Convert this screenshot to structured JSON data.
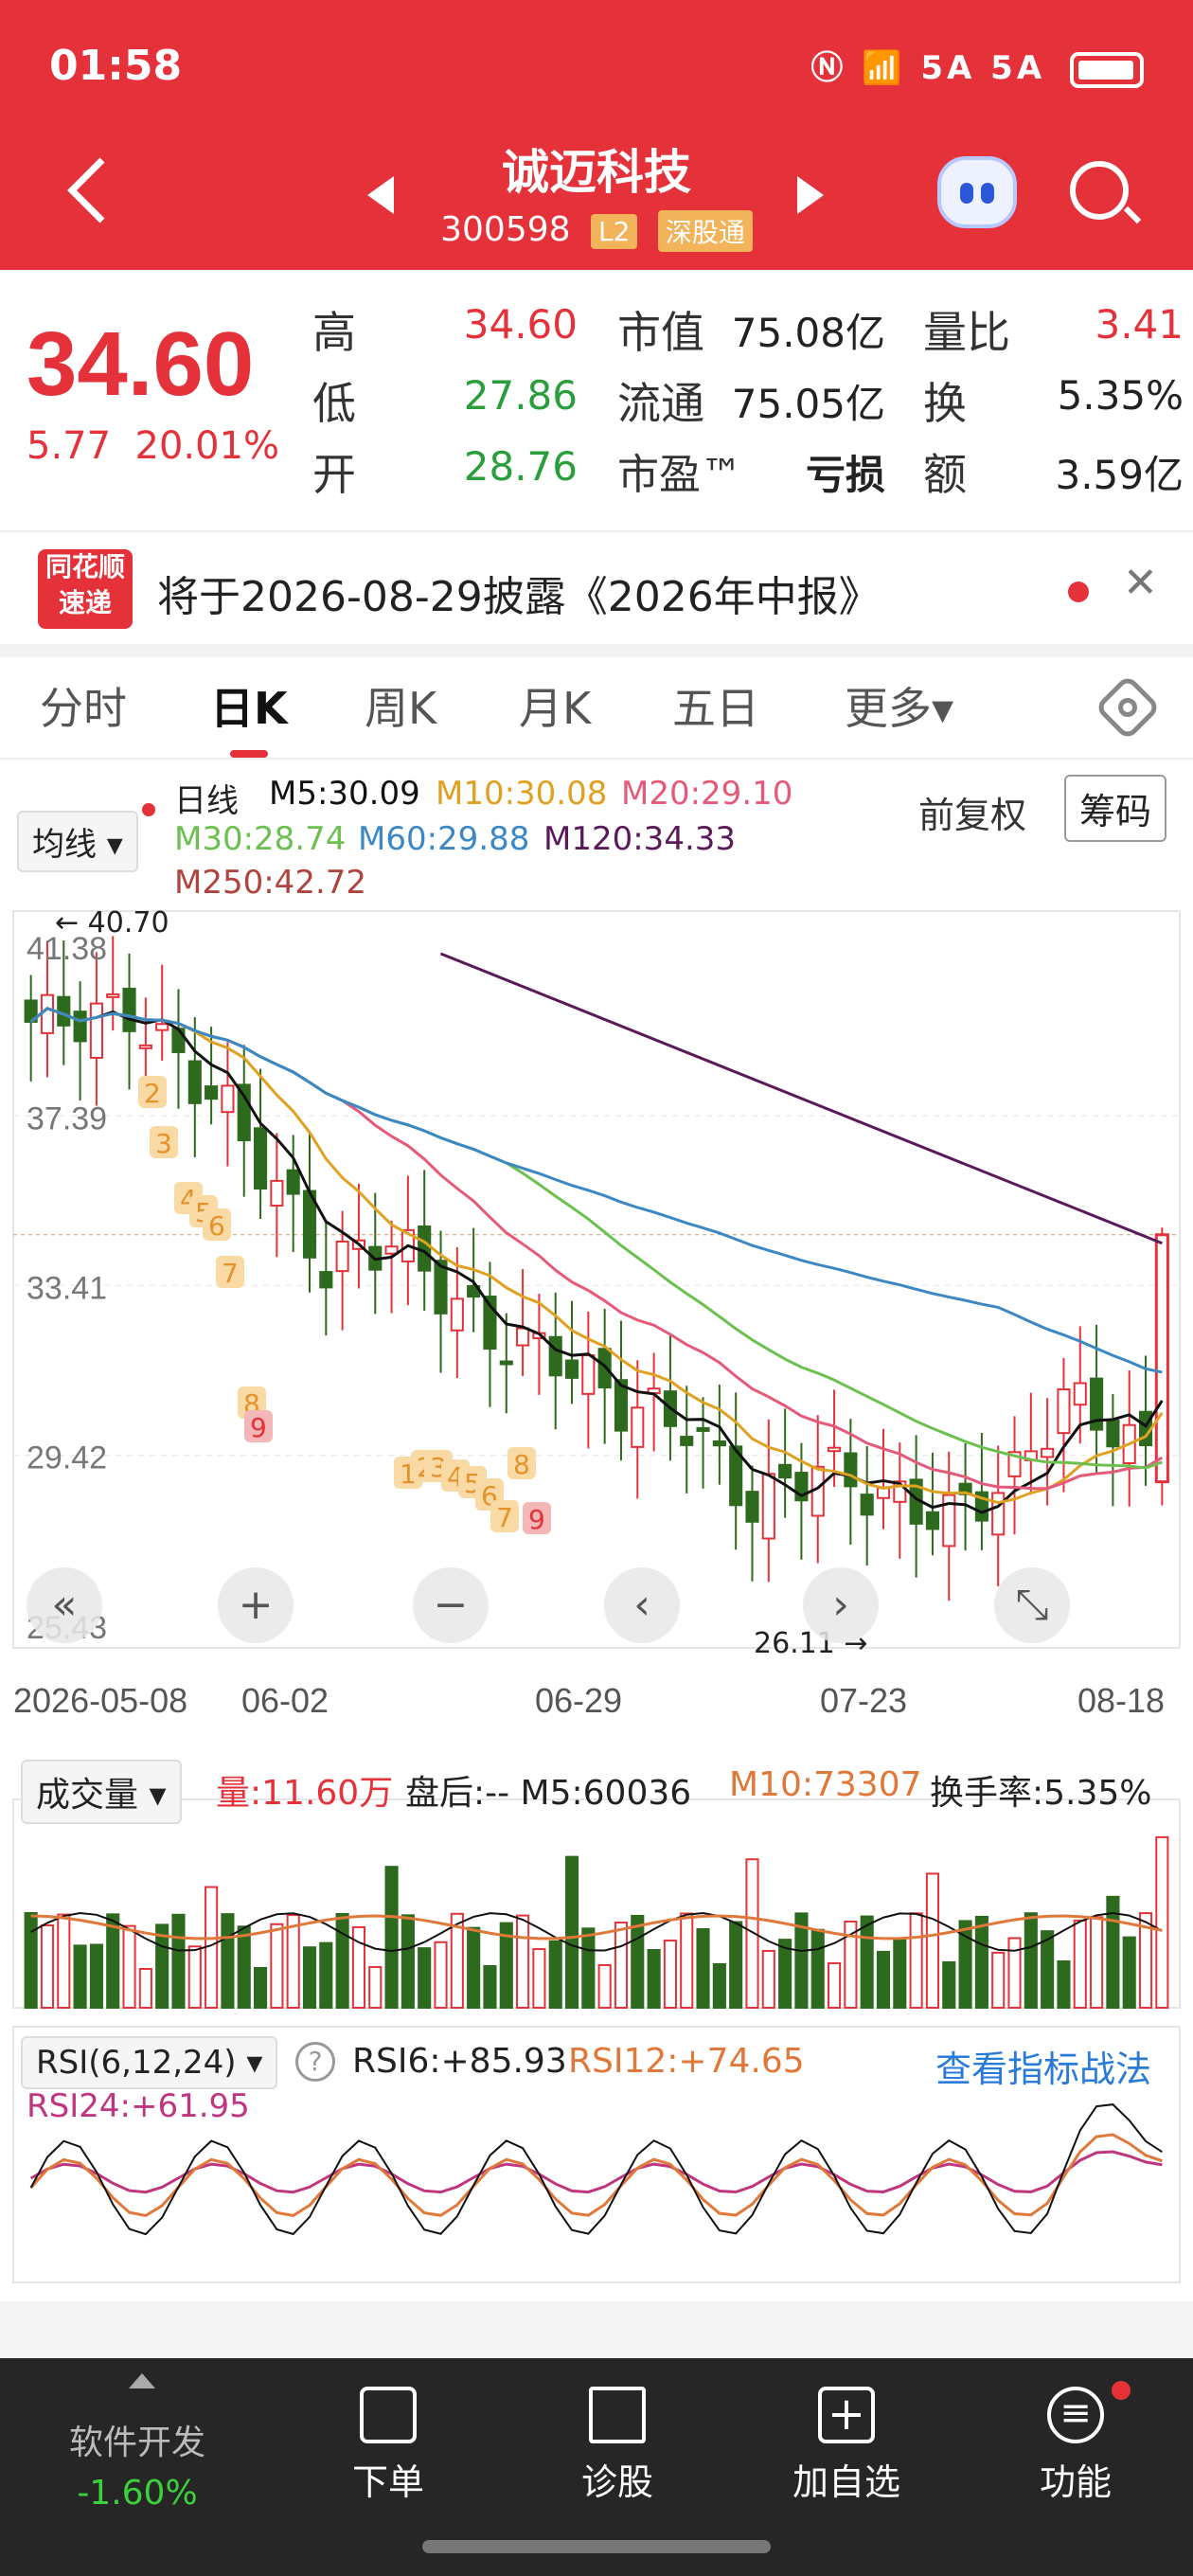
{
  "status_bar": {
    "time": "01:58",
    "signal": "5A 5A"
  },
  "header": {
    "stock_name": "诚迈科技",
    "stock_code": "300598",
    "badge_level": "L2",
    "badge_connect": "深股通"
  },
  "quote": {
    "price": "34.60",
    "change": "5.77",
    "change_pct": "20.01%",
    "high_label": "高",
    "high": "34.60",
    "low_label": "低",
    "low": "27.86",
    "open_label": "开",
    "open": "28.76",
    "mcap_label": "市值",
    "mcap": "75.08亿",
    "float_label": "流通",
    "float": "75.05亿",
    "pe_label": "市盈™",
    "pe": "亏损",
    "vol_ratio_label": "量比",
    "vol_ratio": "3.41",
    "turnover_label": "换",
    "turnover": "5.35%",
    "amount_label": "额",
    "amount": "3.59亿"
  },
  "news": {
    "logo": "同花顺\n速递",
    "text": "将于2026-08-29披露《2026年中报》"
  },
  "tabs": [
    "分时",
    "日K",
    "周K",
    "月K",
    "五日",
    "更多▾"
  ],
  "ma_bar": {
    "selector": "均线 ▾",
    "daily": "日线",
    "m5": "M5:30.09",
    "m10": "M10:30.08",
    "m20": "M20:29.10",
    "m30": "M30:28.74",
    "m60": "M60:29.88",
    "m120": "M120:34.33",
    "m250": "M250:42.72",
    "adjust": "前复权",
    "chips": "筹码"
  },
  "kline": {
    "ticks_y": [
      "41.38",
      "37.39",
      "33.41",
      "29.42",
      "25.43"
    ],
    "ticks_x": [
      "2026-05-08",
      "06-02",
      "06-29",
      "07-23",
      "08-18"
    ],
    "max_label": "40.70",
    "min_label": "26.11",
    "colors": {
      "m5": "#111111",
      "m10": "#e0a020",
      "m20": "#e55a78",
      "m30": "#6cc050",
      "m60": "#3b88c4",
      "m120": "#5a1a5a",
      "up": "#e5323a",
      "down": "#2e6a1e"
    }
  },
  "volume_bar": {
    "selector": "成交量 ▾",
    "vol": "量:11.60万",
    "after": "盘后:-- M5:60036",
    "m10": "M10:73307",
    "turnover": "换手率:5.35%"
  },
  "rsi_bar": {
    "selector": "RSI(6,12,24) ▾",
    "help": "?",
    "rsi6": "RSI6:+85.93",
    "rsi12": "RSI12:+74.65",
    "rsi24": "RSI24:+61.95",
    "link": "查看指标战法"
  },
  "bottom_nav": {
    "left_title": "软件开发",
    "left_value": "-1.60%",
    "items": [
      "下单",
      "诊股",
      "加自选",
      "功能"
    ]
  }
}
